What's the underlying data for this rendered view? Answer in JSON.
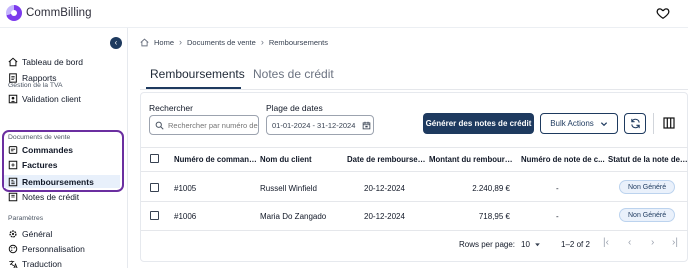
{
  "app": {
    "name": "CommBilling"
  },
  "sidebar": {
    "top_items": [
      {
        "label": "Tableau de bord",
        "icon": "home-icon"
      },
      {
        "label": "Rapports",
        "icon": "report-icon"
      }
    ],
    "sections": [
      {
        "title": "Gestion de la TVA",
        "items": [
          {
            "label": "Validation client",
            "icon": "user-check-icon"
          }
        ]
      },
      {
        "title": "Documents de vente",
        "items": [
          {
            "label": "Commandes",
            "icon": "cart-icon"
          },
          {
            "label": "Factures",
            "icon": "invoice-icon"
          },
          {
            "label": "Remboursements",
            "icon": "refund-icon",
            "active": true
          },
          {
            "label": "Notes de crédit",
            "icon": "credit-note-icon"
          }
        ]
      },
      {
        "title": "Paramètres",
        "items": [
          {
            "label": "Général",
            "icon": "gear-icon"
          },
          {
            "label": "Personnalisation",
            "icon": "palette-icon"
          },
          {
            "label": "Traduction",
            "icon": "translate-icon"
          }
        ]
      }
    ]
  },
  "breadcrumb": {
    "items": [
      "Home",
      "Documents de vente",
      "Remboursements"
    ]
  },
  "tabs": [
    {
      "label": "Remboursements",
      "active": true
    },
    {
      "label": "Notes de crédit",
      "active": false
    }
  ],
  "filters": {
    "search_label": "Rechercher",
    "search_placeholder": "Rechercher par numéro de",
    "date_label": "Plage de dates",
    "date_value": "01-01-2024 - 31-12-2024"
  },
  "actions": {
    "generate": "Générer des notes de crédit",
    "bulk": "Bulk Actions"
  },
  "table": {
    "columns": [
      "Numéro de commande",
      "Nom du client",
      "Date de remboursem...",
      "Montant du rembours...",
      "Numéro de note de c...",
      "Statut de la note de c..."
    ],
    "rows": [
      {
        "order": "#1005",
        "client": "Russell Winfield",
        "date": "20-12-2024",
        "amount": "2.240,89 €",
        "note": "-",
        "status": "Non Généré"
      },
      {
        "order": "#1006",
        "client": "Maria Do Zangado",
        "date": "20-12-2024",
        "amount": "718,95 €",
        "note": "-",
        "status": "Non Généré"
      }
    ]
  },
  "pagination": {
    "rows_label": "Rows per page:",
    "rows_value": "10",
    "range": "1–2 of 2"
  },
  "colors": {
    "primary": "#1e3a5f",
    "highlight": "#6b2fa0",
    "badge_bg": "#eaf1fb"
  }
}
